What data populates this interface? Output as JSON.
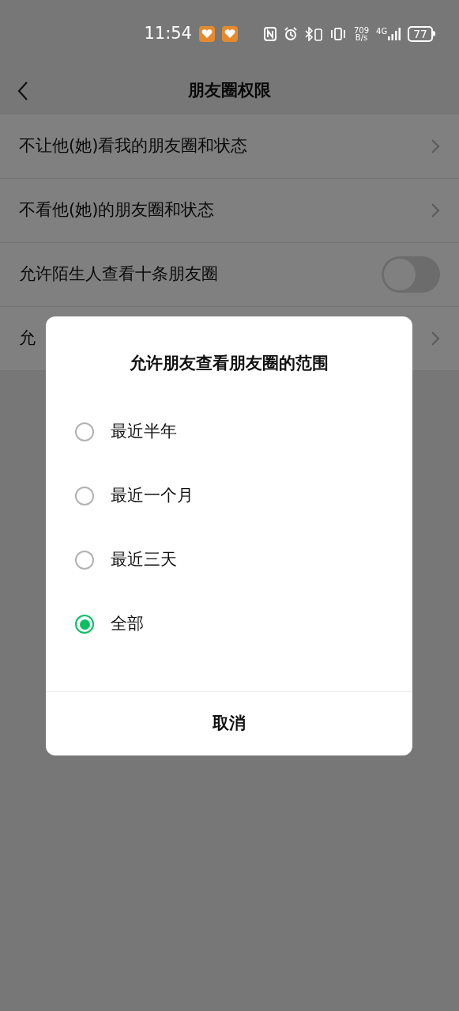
{
  "status_bar": {
    "time": "11:54",
    "speed_value": "709",
    "speed_unit": "B/s",
    "network": "4G",
    "battery": "77"
  },
  "header": {
    "title": "朋友圈权限"
  },
  "rows": [
    {
      "kind": "link",
      "label": "不让他(她)看我的朋友圈和状态"
    },
    {
      "kind": "link",
      "label": "不看他(她)的朋友圈和状态"
    },
    {
      "kind": "toggle",
      "label": "允许陌生人查看十条朋友圈",
      "on": false
    },
    {
      "kind": "link",
      "label": "允"
    }
  ],
  "dialog": {
    "title": "允许朋友查看朋友圈的范围",
    "options": [
      {
        "label": "最近半年",
        "selected": false
      },
      {
        "label": "最近一个月",
        "selected": false
      },
      {
        "label": "最近三天",
        "selected": false
      },
      {
        "label": "全部",
        "selected": true
      }
    ],
    "cancel": "取消"
  }
}
